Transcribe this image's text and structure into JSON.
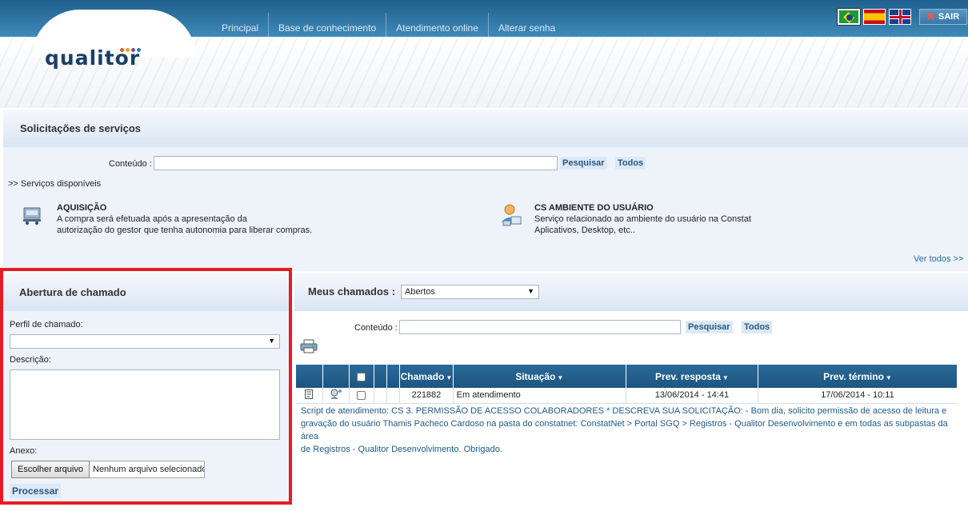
{
  "header": {
    "logo_text": "qualitor",
    "nav": [
      "Principal",
      "Base de conhecimento",
      "Atendimento online",
      "Alterar senha"
    ],
    "sair_label": "SAIR"
  },
  "servicos": {
    "title": "Solicitações de serviços",
    "conteudo_label": "Conteúdo :",
    "search_value": "",
    "pesquisar_label": "Pesquisar",
    "todos_label": "Todos",
    "disponiveis_label": ">> Serviços disponíveis",
    "items": [
      {
        "title": "AQUISIÇÃO",
        "desc1": "A compra será efetuada após a apresentação da",
        "desc2": "autorização do gestor que tenha autonomia para liberar compras."
      },
      {
        "title": "CS AMBIENTE DO USUÁRIO",
        "desc1": "Serviço relacionado ao ambiente do usuário na Constat",
        "desc2": "Aplicativos, Desktop, etc.."
      }
    ],
    "ver_todos_label": "Ver todos >>"
  },
  "abertura": {
    "title": "Abertura de chamado",
    "perfil_label": "Perfil de chamado:",
    "perfil_value": "",
    "descricao_label": "Descrição:",
    "descricao_value": "",
    "anexo_label": "Anexo:",
    "file_button_label": "Escolher arquivo",
    "file_status": "Nenhum arquivo selecionado",
    "processar_label": "Processar"
  },
  "meus": {
    "title": "Meus chamados :",
    "filter_value": "Abertos",
    "conteudo_label": "Conteúdo :",
    "search_value": "",
    "pesquisar_label": "Pesquisar",
    "todos_label": "Todos",
    "columns": [
      "Chamado",
      "Situação",
      "Prev. resposta",
      "Prev. término"
    ],
    "rows": [
      {
        "chamado": "221882",
        "situacao": "Em atendimento",
        "prev_resposta": "13/06/2014 - 14:41",
        "prev_termino": "17/06/2014 - 10:11",
        "script_line1": "Script de atendimento: CS 3. PERMISSÃO DE ACESSO COLABORADORES * DESCREVA SUA SOLICITAÇÃO: - Bom dia, solicito permissão de acesso de leitura e",
        "script_line2": "gravação do usuário Thamis Pacheco Cardoso na pasta do constatnet: ConstatNet > Portal SGQ > Registros - Qualitor Desenvolvimento e em todas as subpastas da área",
        "script_line3": "de Registros - Qualitor Desenvolvimento. Obrigado."
      }
    ]
  },
  "colors": {
    "topbar": "#2a6f9f",
    "panel_header": "#d9e5f5",
    "grid_header": "#1d5582",
    "highlight_frame": "#e51c24",
    "link": "#2b6b9c"
  }
}
